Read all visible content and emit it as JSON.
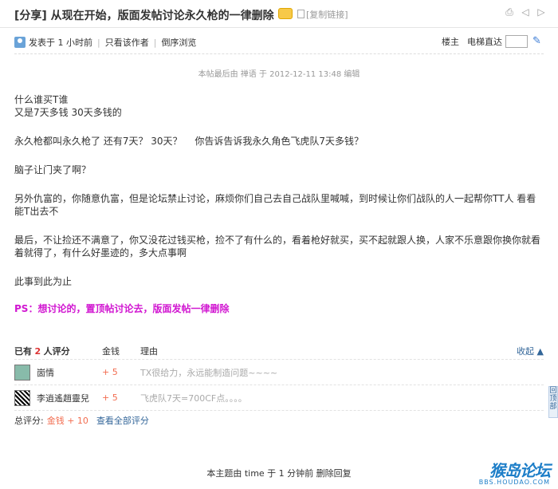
{
  "title": "[分享] 从现在开始，版面发帖讨论永久枪的一律删除",
  "copy_link": "[复制链接]",
  "topbar_icons": [
    "print-icon",
    "prev-icon",
    "next-icon"
  ],
  "meta": {
    "posted": "发表于 1 小时前",
    "author_only": "只看该作者",
    "reverse": "倒序浏览",
    "floor": "楼主",
    "jump_label": "电梯直达"
  },
  "edit_note": "本帖最后由 禅语 于 2012-12-11 13:48 编辑",
  "paragraphs": [
    "什么谁买T谁\n又是7天多钱 30天多钱的",
    "永久枪都叫永久枪了 还有7天？ 30天？　 你告诉告诉我永久角色飞虎队7天多钱？",
    "脑子让门夹了啊？",
    "另外仇富的，你随意仇富，但是论坛禁止讨论，麻烦你们自己去自己战队里喊喊，到时候让你们战队的人一起帮你TT人 看看能T出去不",
    "最后，不让捡还不满意了，你又没花过钱买枪，捡不了有什么的，看着枪好就买，买不起就跟人换，人家不乐意跟你换你就看着就得了，有什么好墨迹的，多大点事啊",
    "此事到此为止"
  ],
  "ps": "PS：想讨论的，置顶帖讨论去，版面发帖一律删除",
  "ratings": {
    "header_prefix": "已有",
    "header_count": "2",
    "header_suffix": "人评分",
    "col_money": "金钱",
    "col_reason": "理由",
    "collapse": "收起 ▲",
    "rows": [
      {
        "user": "崮情",
        "money": "+ 5",
        "reason": "TX很给力，永远能制造问题~~~~"
      },
      {
        "user": "李逍遙趙靈兒",
        "money": "+ 5",
        "reason": "飞虎队7天=700CF点。。。。"
      }
    ],
    "summary_label": "总评分:",
    "summary_money": "金钱 + 10",
    "view_all": "查看全部评分"
  },
  "footer_note": "本主题由 time 于 1 分钟前 删除回复",
  "side_tab": "回顶部",
  "watermark": {
    "main": "猴岛论坛",
    "sub": "BBS.HOUDAO.COM"
  }
}
